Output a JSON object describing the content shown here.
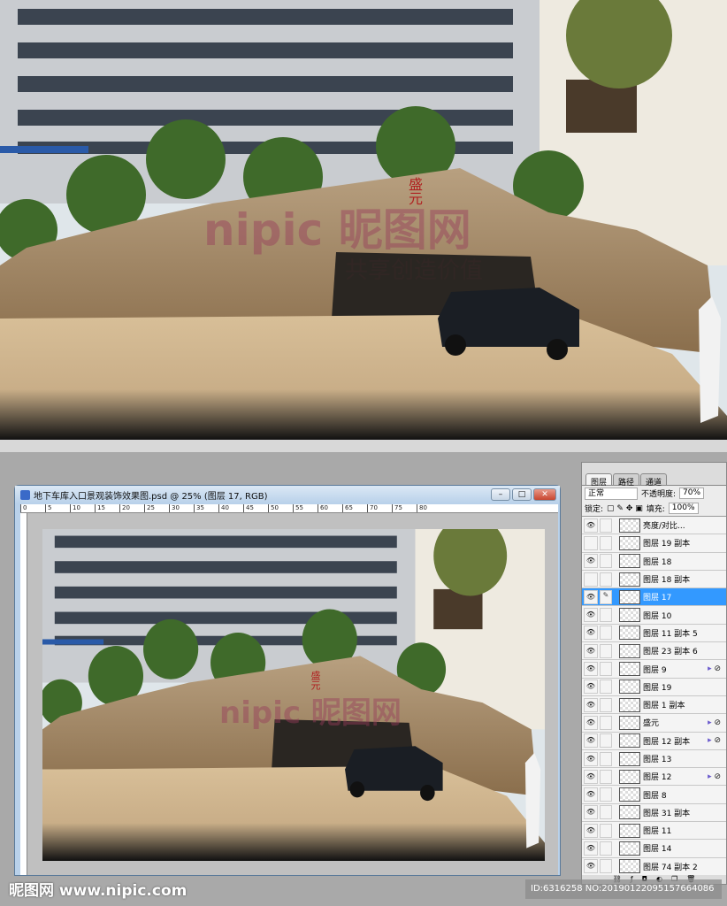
{
  "photo": {
    "rock_text": "盛元",
    "watermark_big": "nipic 昵图网",
    "watermark_sub": "共享创造价值"
  },
  "document": {
    "title": "地下车库入口景观装饰效果图.psd @ 25% (图层 17, RGB)",
    "buttons": {
      "minimize": "–",
      "maximize": "□",
      "close": "✕"
    },
    "ruler_ticks": [
      "0",
      "5",
      "10",
      "15",
      "20",
      "25",
      "30",
      "35",
      "40",
      "45",
      "50",
      "55",
      "60",
      "65",
      "70",
      "75",
      "80"
    ]
  },
  "layers_panel": {
    "tabs": [
      "图层",
      "路径",
      "通道"
    ],
    "blend_mode": "正常",
    "opacity_label": "不透明度:",
    "opacity": "70%",
    "lock_label": "锁定:",
    "fill_label": "填充:",
    "fill": "100%",
    "layers": [
      {
        "name": "亮度/对比...",
        "visible": true
      },
      {
        "name": "图层 19 副本",
        "visible": false
      },
      {
        "name": "图层 18",
        "visible": true
      },
      {
        "name": "图层 18 副本",
        "visible": false
      },
      {
        "name": "图层 17",
        "visible": true,
        "selected": true
      },
      {
        "name": "图层 10",
        "visible": true
      },
      {
        "name": "图层 11 副本 5",
        "visible": true
      },
      {
        "name": "图层 23 副本 6",
        "visible": true
      },
      {
        "name": "图层 9",
        "visible": true,
        "fx": true
      },
      {
        "name": "图层 19",
        "visible": true
      },
      {
        "name": "图层 1 副本",
        "visible": true
      },
      {
        "name": "盛元",
        "visible": true,
        "fx": true
      },
      {
        "name": "图层 12 副本",
        "visible": true,
        "fx": true
      },
      {
        "name": "图层 13",
        "visible": true
      },
      {
        "name": "图层 12",
        "visible": true,
        "fx": true
      },
      {
        "name": "图层 8",
        "visible": true
      },
      {
        "name": "图层 31 副本",
        "visible": true
      },
      {
        "name": "图层 11",
        "visible": true
      },
      {
        "name": "图层 14",
        "visible": true
      },
      {
        "name": "图层 74 副本 2",
        "visible": true
      }
    ]
  },
  "watermark": {
    "logo": "昵图网 www.nipic.com",
    "id": "ID:6316258 NO:20190122095157664086"
  }
}
